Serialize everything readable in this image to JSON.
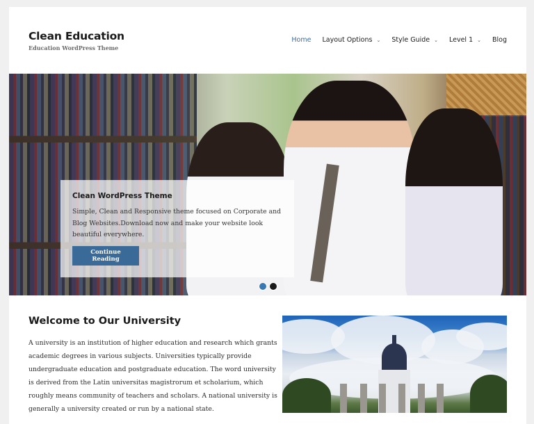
{
  "header": {
    "site_title": "Clean Education",
    "site_description": "Education WordPress Theme"
  },
  "nav": {
    "items": [
      {
        "label": "Home",
        "active": true,
        "has_dropdown": false
      },
      {
        "label": "Layout Options",
        "active": false,
        "has_dropdown": true
      },
      {
        "label": "Style Guide",
        "active": false,
        "has_dropdown": true
      },
      {
        "label": "Level 1",
        "active": false,
        "has_dropdown": true
      },
      {
        "label": "Blog",
        "active": false,
        "has_dropdown": false
      }
    ],
    "dropdown_icon": "chevron-down-icon",
    "active_color": "#3b6aa0"
  },
  "hero": {
    "caption_title": "Clean WordPress Theme",
    "caption_text": "Simple, Clean and Responsive theme focused on Corporate and Blog Websites.Download now and make your website look beautiful everywhere.",
    "button_label": "Continue Reading",
    "button_color": "#3a6a98",
    "slides": [
      {
        "active": true
      },
      {
        "active": false
      }
    ]
  },
  "welcome": {
    "title": "Welcome to Our University",
    "text": "A university is an institution of higher education and research which grants academic degrees in various subjects. Universities typically provide undergraduate education and postgraduate education. The word university is derived from the Latin universitas magistrorum et scholarium, which roughly means community of teachers and scholars. A national university is generally a university created or run by a national state."
  }
}
